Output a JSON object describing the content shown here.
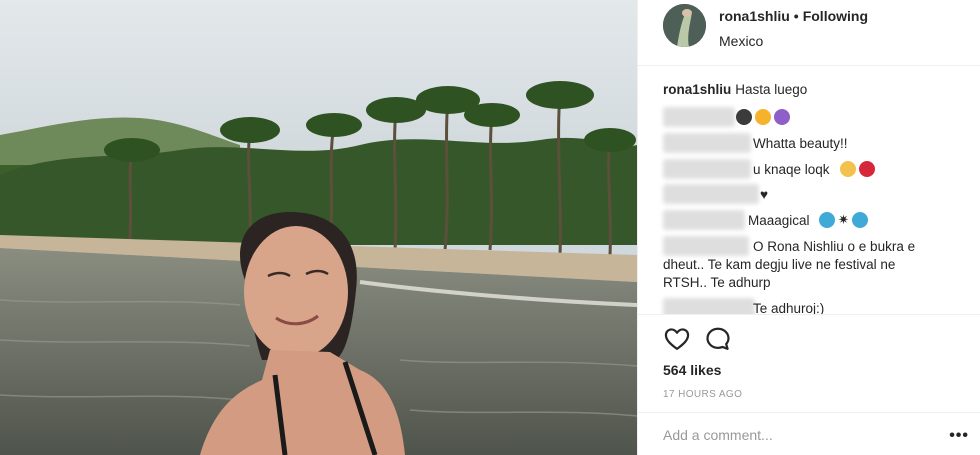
{
  "post": {
    "username": "rona1shliu",
    "separator": "•",
    "follow_status": "Following",
    "location": "Mexico"
  },
  "comments": {
    "caption": {
      "user": "rona1shliu",
      "text": "Hasta luego"
    },
    "items": [
      {
        "text": "Whatta beauty!!"
      },
      {
        "text": "u knaqe loqk"
      },
      {
        "text": "♥"
      },
      {
        "text": "Maaagical"
      },
      {
        "text": "O Rona Nishliu o e bukra e"
      },
      {
        "text": "dheut.. Te kam degju live ne festival ne"
      },
      {
        "text": "RTSH.. Te adhurp"
      },
      {
        "text": "Te adhuroj:)"
      }
    ]
  },
  "actions": {
    "like_icon": "heart-outline-icon",
    "comment_icon": "speech-bubble-icon",
    "likes": "564 likes",
    "timestamp": "17 HOURS AGO"
  },
  "add_comment": {
    "placeholder": "Add a comment...",
    "more_label": "•••"
  },
  "colors": {
    "text": "#262626",
    "muted": "#999999",
    "border": "#efefef",
    "sky": "#dfe6ea",
    "water": "#6b7068",
    "palm": "#3f6b2a"
  }
}
